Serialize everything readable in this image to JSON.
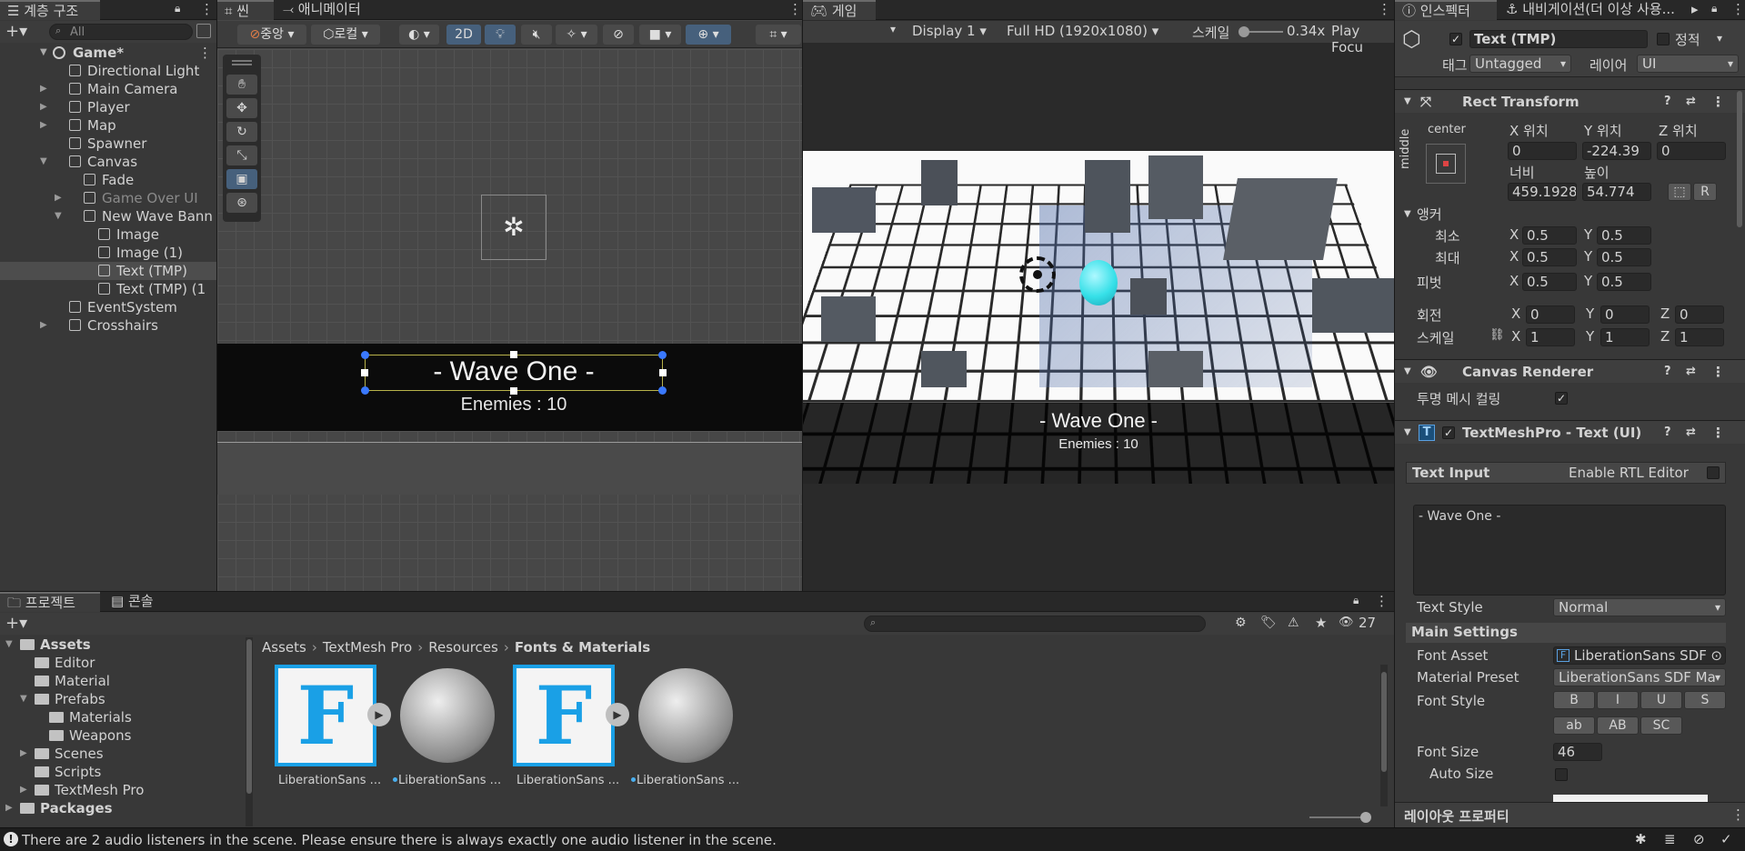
{
  "hierarchy": {
    "tab_label": "계층 구조",
    "search_placeholder": "All",
    "scene_name": "Game*",
    "items": [
      {
        "label": "Directional Light",
        "indent": 1,
        "expand": false
      },
      {
        "label": "Main Camera",
        "indent": 1,
        "expand": true
      },
      {
        "label": "Player",
        "indent": 1,
        "expand": true
      },
      {
        "label": "Map",
        "indent": 1,
        "expand": true
      },
      {
        "label": "Spawner",
        "indent": 1,
        "expand": false
      },
      {
        "label": "Canvas",
        "indent": 1,
        "expand": true
      },
      {
        "label": "Fade",
        "indent": 2,
        "expand": false
      },
      {
        "label": "Game Over UI",
        "indent": 2,
        "expand": true
      },
      {
        "label": "New Wave Bann",
        "indent": 2,
        "expand": true
      },
      {
        "label": "Image",
        "indent": 3,
        "expand": false
      },
      {
        "label": "Image (1)",
        "indent": 3,
        "expand": false
      },
      {
        "label": "Text (TMP)",
        "indent": 3,
        "expand": false
      },
      {
        "label": "Text (TMP) (1",
        "indent": 3,
        "expand": false
      },
      {
        "label": "EventSystem",
        "indent": 1,
        "expand": false
      },
      {
        "label": "Crosshairs",
        "indent": 1,
        "expand": true
      }
    ]
  },
  "scene": {
    "tab_label": "씬",
    "anim_tab_label": "애니메이터",
    "pivot_label": "중앙",
    "space_label": "로컬",
    "mode_2d": "2D",
    "wave_text": "- Wave One -",
    "enemies_text": "Enemies : 10"
  },
  "game": {
    "tab_label": "게임",
    "display": "Display 1",
    "resolution": "Full HD (1920x1080)",
    "scale_label": "스케일",
    "scale_value": "0.34x",
    "play_focus": "Play Focu",
    "wave_text": "- Wave One -",
    "enemies_text": "Enemies : 10"
  },
  "inspector": {
    "tab_label": "인스펙터",
    "nav_tab_label": "내비게이션(더 이상 사용...",
    "object_name": "Text (TMP)",
    "static_label": "정적",
    "tag_label": "태그",
    "tag_value": "Untagged",
    "layer_label": "레이어",
    "layer_value": "UI",
    "rect_transform": {
      "title": "Rect Transform",
      "anchor_h": "center",
      "anchor_v": "middle",
      "pos_x_label": "X 위치",
      "pos_y_label": "Y 위치",
      "pos_z_label": "Z 위치",
      "pos_x": "0",
      "pos_y": "-224.39",
      "pos_z": "0",
      "width_label": "너비",
      "height_label": "높이",
      "width": "459.1928",
      "height": "54.774",
      "r_btn": "R",
      "anchors_label": "앵커",
      "min_label": "최소",
      "max_label": "최대",
      "pivot_label": "피벗",
      "min_x": "0.5",
      "min_y": "0.5",
      "max_x": "0.5",
      "max_y": "0.5",
      "pivot_x": "0.5",
      "pivot_y": "0.5",
      "rotation_label": "회전",
      "scale_label": "스케일",
      "rot_x": "0",
      "rot_y": "0",
      "rot_z": "0",
      "scale_x": "1",
      "scale_y": "1",
      "scale_z": "1"
    },
    "canvas_renderer": {
      "title": "Canvas Renderer",
      "cull_label": "투명 메시 컬링"
    },
    "tmp": {
      "title": "TextMeshPro - Text (UI)",
      "text_input_label": "Text Input",
      "rtl_label": "Enable RTL Editor",
      "text_value": "- Wave One -",
      "text_style_label": "Text Style",
      "text_style_value": "Normal",
      "main_settings": "Main Settings",
      "font_asset_label": "Font Asset",
      "font_asset_value": "LiberationSans SDF",
      "material_preset_label": "Material Preset",
      "material_preset_value": "LiberationSans SDF Ma",
      "font_style_label": "Font Style",
      "style_buttons": [
        "B",
        "I",
        "U",
        "S",
        "ab",
        "AB",
        "SC"
      ],
      "font_size_label": "Font Size",
      "font_size_value": "46",
      "auto_size_label": "Auto Size"
    },
    "layout_label": "레이아웃 프로퍼티"
  },
  "project": {
    "tab_label": "프로젝트",
    "console_label": "콘솔",
    "hidden_count": "27",
    "tree": [
      {
        "label": "Assets",
        "indent": 0,
        "bold": true,
        "expand": true
      },
      {
        "label": "Editor",
        "indent": 1,
        "bold": false,
        "expand": false
      },
      {
        "label": "Material",
        "indent": 1,
        "bold": false,
        "expand": false
      },
      {
        "label": "Prefabs",
        "indent": 1,
        "bold": false,
        "expand": true
      },
      {
        "label": "Materials",
        "indent": 2,
        "bold": false,
        "expand": false
      },
      {
        "label": "Weapons",
        "indent": 2,
        "bold": false,
        "expand": false
      },
      {
        "label": "Scenes",
        "indent": 1,
        "bold": false,
        "expand": true
      },
      {
        "label": "Scripts",
        "indent": 1,
        "bold": false,
        "expand": false
      },
      {
        "label": "TextMesh Pro",
        "indent": 1,
        "bold": false,
        "expand": true
      },
      {
        "label": "Packages",
        "indent": 0,
        "bold": true,
        "expand": true
      }
    ],
    "breadcrumb": [
      "Assets",
      "TextMesh Pro",
      "Resources",
      "Fonts & Materials"
    ],
    "assets": [
      {
        "label": "LiberationSans ...",
        "kind": "font"
      },
      {
        "label": "LiberationSans ...",
        "kind": "material"
      },
      {
        "label": "LiberationSans ...",
        "kind": "font"
      },
      {
        "label": "LiberationSans ...",
        "kind": "material"
      }
    ]
  },
  "status": {
    "message": "There are 2 audio listeners in the scene. Please ensure there is always exactly one audio listener in the scene."
  },
  "colors": {
    "accent_blue": "#3a79bb",
    "selection": "#2c5d87",
    "font_icon": "#1aa0e6",
    "cyan_player": "#36e0e8"
  }
}
